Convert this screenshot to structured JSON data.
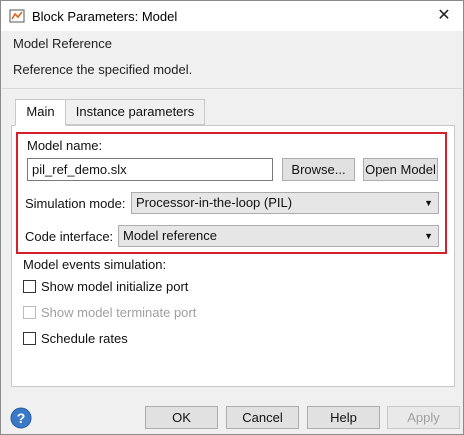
{
  "window": {
    "title": "Block Parameters: Model",
    "close_glyph": "✕"
  },
  "header": {
    "group_title": "Model Reference",
    "description": "Reference the specified model."
  },
  "tabs": [
    {
      "label": "Main",
      "active": true
    },
    {
      "label": "Instance parameters",
      "active": false
    }
  ],
  "main": {
    "model_name_label": "Model name:",
    "model_name_value": "pil_ref_demo.slx",
    "browse_label": "Browse...",
    "open_model_label": "Open Model",
    "sim_mode_label": "Simulation mode:",
    "sim_mode_value": "Processor-in-the-loop (PIL)",
    "code_interface_label": "Code interface:",
    "code_interface_value": "Model reference",
    "events_label": "Model events simulation:",
    "checkboxes": [
      {
        "label": "Show model initialize port",
        "checked": false,
        "enabled": true
      },
      {
        "label": "Show model terminate port",
        "checked": false,
        "enabled": false
      },
      {
        "label": "Schedule rates",
        "checked": false,
        "enabled": true
      }
    ]
  },
  "footer": {
    "ok_label": "OK",
    "cancel_label": "Cancel",
    "help_label": "Help",
    "apply_label": "Apply"
  },
  "colors": {
    "highlight": "#d3202a",
    "help_icon": "#3a78c8"
  },
  "icons": {
    "app": "simulink-block-icon",
    "help": "help-icon",
    "dropdown": "chevron-down-icon"
  }
}
